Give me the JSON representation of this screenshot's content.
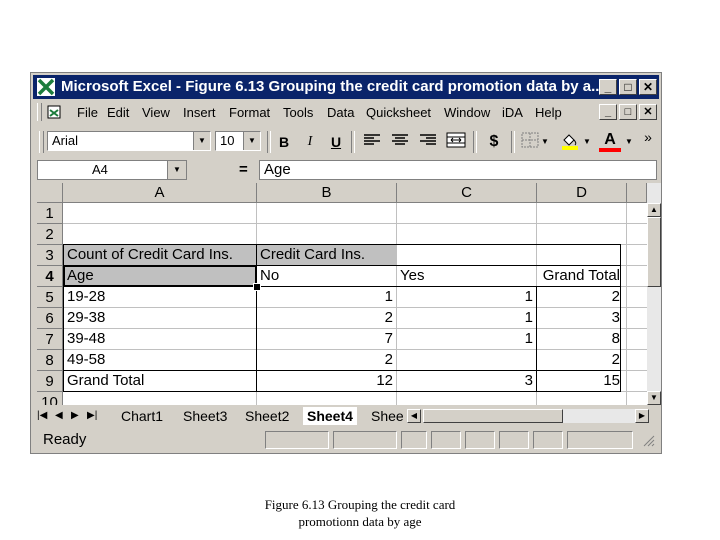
{
  "window": {
    "title": "Microsoft Excel - Figure 6.13 Grouping the credit card promotion data by a...",
    "buttons": {
      "minimize": "_",
      "maximize": "□",
      "close": "✕"
    }
  },
  "menu": [
    "File",
    "Edit",
    "View",
    "Insert",
    "Format",
    "Tools",
    "Data",
    "Quicksheet",
    "Window",
    "iDA",
    "Help"
  ],
  "toolbar": {
    "font": "Arial",
    "size": "10",
    "bold": "B",
    "italic": "I",
    "underline": "U",
    "currency": "$",
    "font_color_letter": "A",
    "more": "»"
  },
  "formula_bar": {
    "cell_ref": "A4",
    "equals": "=",
    "value": "Age"
  },
  "sheet": {
    "columns": [
      "A",
      "B",
      "C",
      "D"
    ],
    "rows": [
      "1",
      "2",
      "3",
      "4",
      "5",
      "6",
      "7",
      "8",
      "9",
      "10"
    ],
    "cells": {
      "A3": "Count of Credit Card Ins.",
      "B3": "Credit Card Ins.",
      "A4": "Age",
      "B4": "No",
      "C4": "Yes",
      "D4": "Grand Total",
      "A5": "19-28",
      "B5": "1",
      "C5": "1",
      "D5": "2",
      "A6": "29-38",
      "B6": "2",
      "C6": "1",
      "D6": "3",
      "A7": "39-48",
      "B7": "7",
      "C7": "1",
      "D7": "8",
      "A8": "49-58",
      "B8": "2",
      "C8": "",
      "D8": "2",
      "A9": "Grand Total",
      "B9": "12",
      "C9": "3",
      "D9": "15"
    }
  },
  "tabs": [
    "Chart1",
    "Sheet3",
    "Sheet2",
    "Sheet4",
    "Shee"
  ],
  "active_tab": "Sheet4",
  "status": "Ready",
  "caption": {
    "line1": "Figure 6.13 Grouping the credit card",
    "line2": "promotionn data by age"
  },
  "colors": {
    "titlebar": "#0a246a",
    "chrome": "#d4d0c8",
    "highlight": "#ffff00",
    "font_color": "#ff0000"
  }
}
